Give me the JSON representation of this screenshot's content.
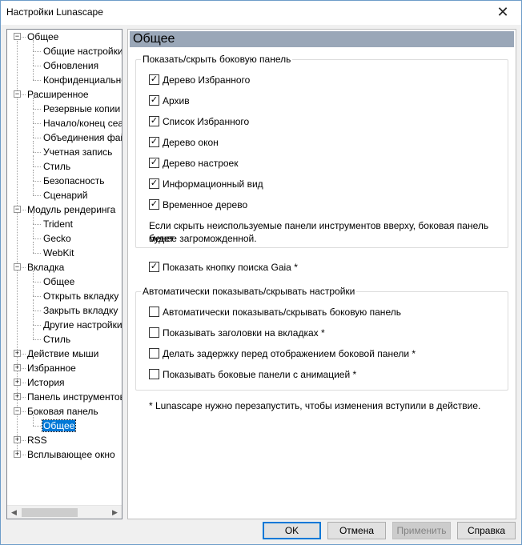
{
  "window": {
    "title": "Настройки Lunascape",
    "close_glyph": "✕"
  },
  "tree": {
    "items": [
      {
        "label": "Общее",
        "level": 0,
        "box": "−"
      },
      {
        "label": "Общие настройки",
        "level": 1
      },
      {
        "label": "Обновления",
        "level": 1
      },
      {
        "label": "Конфиденциальность",
        "level": 1
      },
      {
        "label": "Расширенное",
        "level": 0,
        "box": "−"
      },
      {
        "label": "Резервные копии",
        "level": 1
      },
      {
        "label": "Начало/конец сеанса",
        "level": 1
      },
      {
        "label": "Объединения файлов",
        "level": 1
      },
      {
        "label": "Учетная запись",
        "level": 1
      },
      {
        "label": "Стиль",
        "level": 1
      },
      {
        "label": "Безопасность",
        "level": 1
      },
      {
        "label": "Сценарий",
        "level": 1
      },
      {
        "label": "Модуль рендеринга",
        "level": 0,
        "box": "−"
      },
      {
        "label": "Trident",
        "level": 1
      },
      {
        "label": "Gecko",
        "level": 1
      },
      {
        "label": "WebKit",
        "level": 1
      },
      {
        "label": "Вкладка",
        "level": 0,
        "box": "−"
      },
      {
        "label": "Общее",
        "level": 1
      },
      {
        "label": "Открыть вкладку",
        "level": 1
      },
      {
        "label": "Закрыть вкладку",
        "level": 1
      },
      {
        "label": "Другие настройки",
        "level": 1
      },
      {
        "label": "Стиль",
        "level": 1
      },
      {
        "label": "Действие мыши",
        "level": 0,
        "box": "+"
      },
      {
        "label": "Избранное",
        "level": 0,
        "box": "+"
      },
      {
        "label": "История",
        "level": 0,
        "box": "+"
      },
      {
        "label": "Панель инструментов",
        "level": 0,
        "box": "+"
      },
      {
        "label": "Боковая панель",
        "level": 0,
        "box": "−"
      },
      {
        "label": "Общее",
        "level": 1,
        "selected": true
      },
      {
        "label": "RSS",
        "level": 0,
        "box": "+"
      },
      {
        "label": "Всплывающее окно",
        "level": 0,
        "box": "+"
      }
    ],
    "scroll_left": "◀",
    "scroll_right": "▶"
  },
  "content": {
    "title": "Общее",
    "group1": {
      "legend": "Показать/скрыть боковую панель",
      "checkboxes": [
        {
          "label": "Дерево Избранного",
          "checked": true
        },
        {
          "label": "Архив",
          "checked": true
        },
        {
          "label": "Список Избранного",
          "checked": true
        },
        {
          "label": "Дерево окон",
          "checked": true
        },
        {
          "label": "Дерево настроек",
          "checked": true
        },
        {
          "label": "Информационный вид",
          "checked": true
        },
        {
          "label": "Временное дерево",
          "checked": true
        }
      ],
      "note_line1": "Если скрыть неиспользуемые панели инструментов вверху, боковая панель будет",
      "note_line2": "менее загроможденной."
    },
    "gaia": {
      "label": "Показать кнопку поиска Gaia *",
      "checked": true
    },
    "group2": {
      "legend": "Автоматически показывать/скрывать настройки",
      "checkboxes": [
        {
          "label": "Автоматически показывать/скрывать боковую панель",
          "checked": false
        },
        {
          "label": "Показывать заголовки на вкладках *",
          "checked": false
        },
        {
          "label": "Делать задержку перед отображением боковой панели *",
          "checked": false
        },
        {
          "label": "Показывать боковые панели с анимацией *",
          "checked": false
        }
      ]
    },
    "footnote": "* Lunascape нужно перезапустить, чтобы изменения вступили в действие."
  },
  "buttons": {
    "ok": "OK",
    "cancel": "Отмена",
    "apply": "Применить",
    "help": "Справка"
  }
}
